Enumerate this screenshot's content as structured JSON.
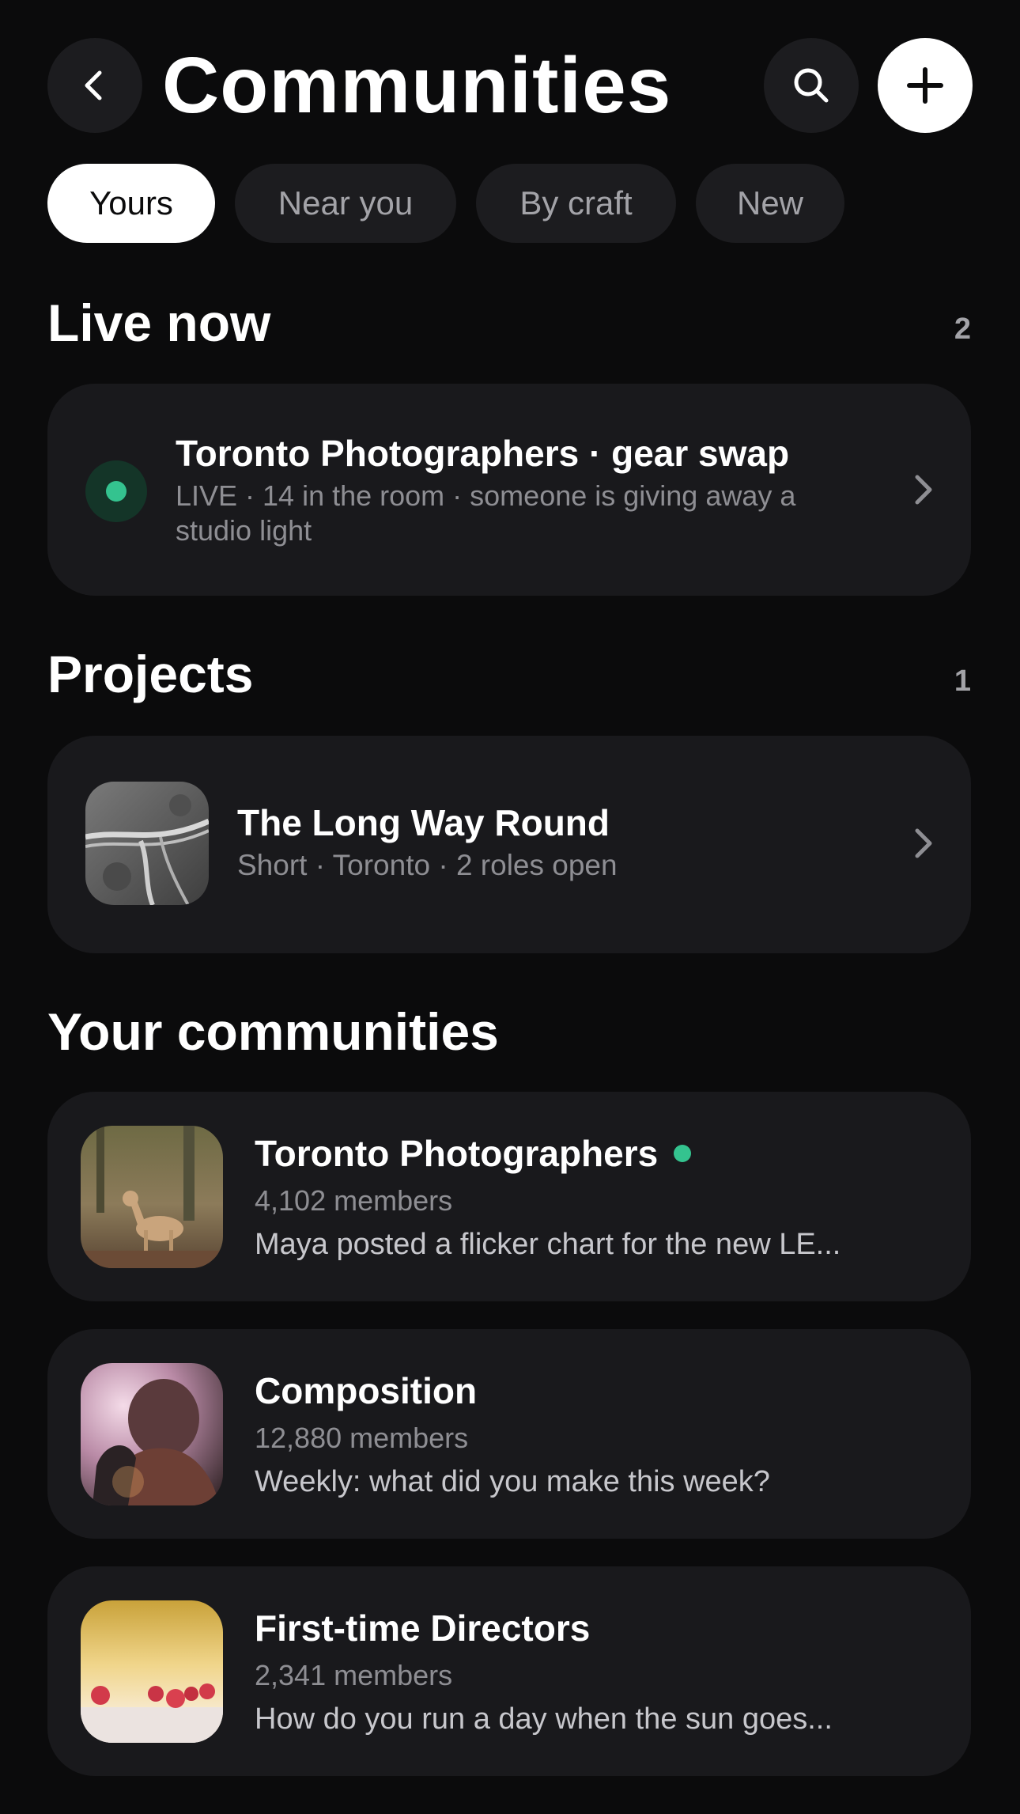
{
  "header": {
    "title": "Communities",
    "back_icon": "chevron-left-icon",
    "search_icon": "search-icon",
    "add_icon": "plus-icon"
  },
  "tabs": [
    {
      "label": "Yours",
      "active": true
    },
    {
      "label": "Near you",
      "active": false
    },
    {
      "label": "By craft",
      "active": false
    },
    {
      "label": "New",
      "active": false
    }
  ],
  "live_now": {
    "title": "Live now",
    "count": "2",
    "item": {
      "title": "Toronto Photographers · gear swap",
      "subtitle": "LIVE · 14 in the room · someone is giving away a studio light"
    }
  },
  "projects": {
    "title": "Projects",
    "count": "1",
    "item": {
      "title": "The Long Way Round",
      "subtitle": "Short · Toronto · 2 roles open"
    }
  },
  "your_communities": {
    "title": "Your communities",
    "items": [
      {
        "name": "Toronto Photographers",
        "members": "4,102 members",
        "preview": "Maya posted a flicker chart for the new LE...",
        "active": true
      },
      {
        "name": "Composition",
        "members": "12,880 members",
        "preview": "Weekly: what did you make this week?",
        "active": false
      },
      {
        "name": "First-time Directors",
        "members": "2,341 members",
        "preview": "How do you run a day when the sun goes...",
        "active": false
      }
    ]
  },
  "colors": {
    "background": "#0b0b0c",
    "card": "#19191c",
    "live_green": "#34c38f",
    "muted_text": "#8e8e93"
  }
}
